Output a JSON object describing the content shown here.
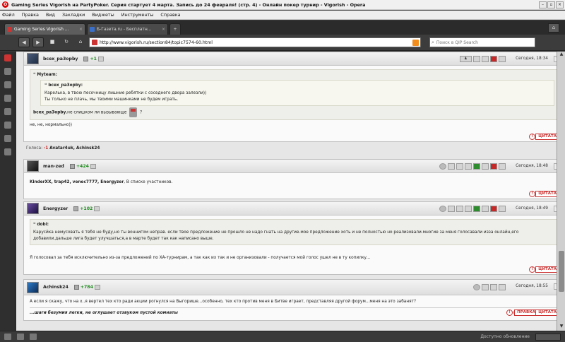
{
  "window": {
    "title": "Gaming Series Vigorish на PartyPoker. Серия стартует 4 марта. Запись до 24 февраля! (стр. 4) - Онлайн покер турнир - Vigorish - Opera"
  },
  "menu": [
    "Файл",
    "Правка",
    "Вид",
    "Закладки",
    "Виджеты",
    "Инструменты",
    "Справка"
  ],
  "tabs": [
    {
      "label": "Gaming Series Vigorish ..."
    },
    {
      "label": "Б-Газета.ru - Бесплатн..."
    }
  ],
  "address": {
    "url": "http://www.vigorish.ru/section84/topic7574-60.html",
    "search_placeholder": "Поиск в QIP Search"
  },
  "labels": {
    "cite": "ЦИТАТА",
    "edit": "ПРАВКА",
    "votes_label": "Голоса:",
    "menu_glyph": "?"
  },
  "posts": [
    {
      "user": "bcex_pa3opby",
      "rep": "+1",
      "date": "Сегодня, 18:34",
      "quote_author": "Myteam:",
      "inner_quote_author": "bcex_pa3opby:",
      "inner_quote_lines": [
        "Карелька, в твою песочницу лишние ребятки с соседнего двора залезли))",
        "Ты только не плачь, мы твоими машинками не будем играть."
      ],
      "quote_reply_author": "bcex_pa3opby",
      "quote_reply_text": ",не слишком ли вызывающе",
      "quote_reply_end": "?",
      "text": "не, не, нормально))",
      "votes_minus": "-1",
      "voters": "Avatar4uk, Achinsk24"
    },
    {
      "user": "man-zed",
      "rep": "+424",
      "date": "Сегодня, 18:48",
      "text_bold": "KinderXX, trap42, venec7777, Energyzer",
      "text": ", В списке участников."
    },
    {
      "user": "Energyzer",
      "rep": "+102",
      "date": "Сегодня, 18:49",
      "quote_author": "dobi:",
      "quote_text": "Карусйка немусовать я тебя не буду,но ты воннигом неправ. если твое предложение не прошло не надо гнать на другие.мое предложение хоть и не полностью но реализовали.многие за меня голосавали изза онлайн,его добавили.дальше лига будет улучшаться,а в марте будет так как написано выше.",
      "text": "Я голосовал за тебя исключительно из-за предложений по ХА-турнирам, а так как их так и не организовали - получается мой голос ушел не в ту копилку..."
    },
    {
      "user": "Achinsk24",
      "rep": "+784",
      "date": "Сегодня, 18:55",
      "text": "А если я скажу, что на х..я вертел тех кто ради акции рогнулся на Выгорише...особенно, тех кто против меня в Битве играет, представляя другой форум...меня на это забанят?",
      "signature": "...шаги безумия легки, не оглушает отзвуком пустой комнаты"
    }
  ],
  "status": {
    "text": "Доступно обновление"
  },
  "colors": {
    "rep_positive": "#1e8a1e",
    "vote_negative": "#c62828",
    "cite_border": "#c33"
  }
}
